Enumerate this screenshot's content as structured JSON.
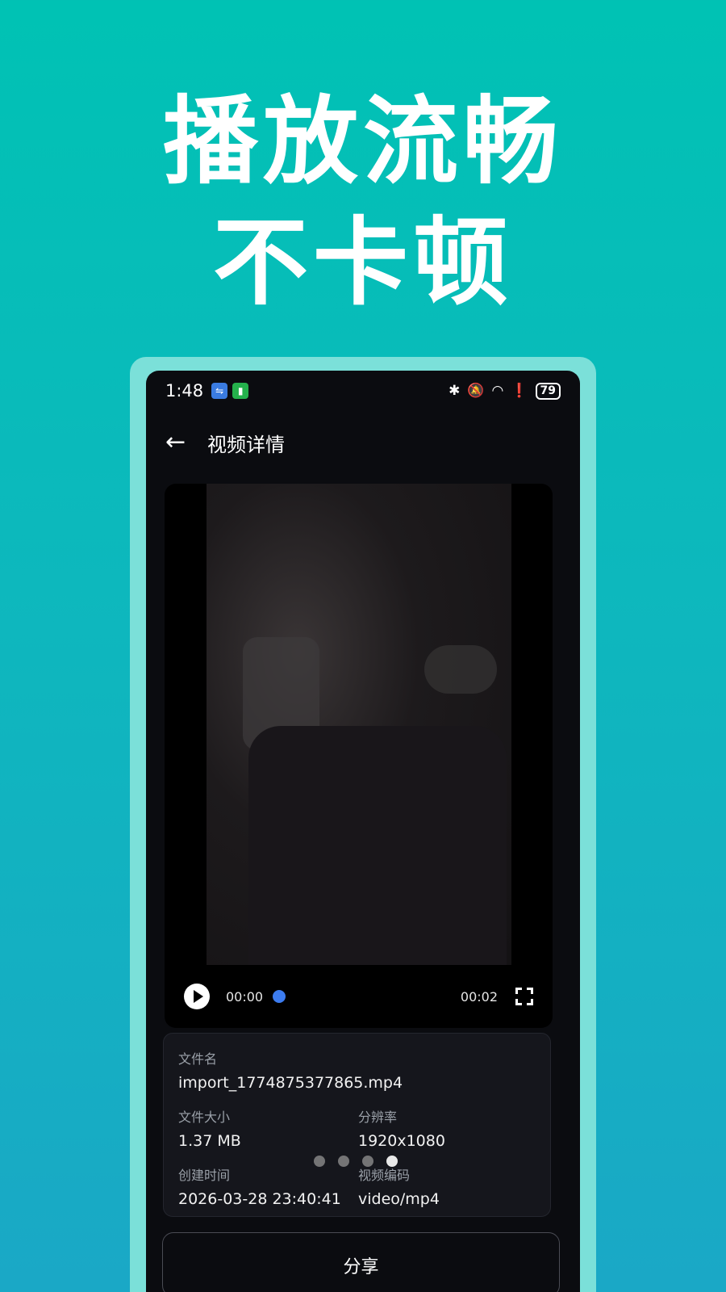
{
  "headline": {
    "line1": "播放流畅",
    "line2": "不卡顿"
  },
  "status_bar": {
    "time": "1:48",
    "battery": "79",
    "icons": [
      "usb-icon",
      "battery-saver-icon",
      "bluetooth-icon",
      "mute-icon",
      "wifi-icon",
      "alert-icon"
    ]
  },
  "topbar": {
    "title": "视频详情"
  },
  "player": {
    "current_time": "00:00",
    "total_time": "00:02",
    "progress": 0.0
  },
  "info": {
    "filename_label": "文件名",
    "filename": "import_1774875377865.mp4",
    "size_label": "文件大小",
    "size": "1.37 MB",
    "resolution_label": "分辨率",
    "resolution": "1920x1080",
    "created_label": "创建时间",
    "created": "2026-03-28 23:40:41",
    "codec_label": "视频编码",
    "codec": "video/mp4"
  },
  "pager": {
    "count": 4,
    "active_index": 3
  },
  "share_label": "分享",
  "colors": {
    "accent": "#3c7cf0",
    "bg_top": "#00c2b4",
    "bg_bottom": "#1aa8c6"
  }
}
